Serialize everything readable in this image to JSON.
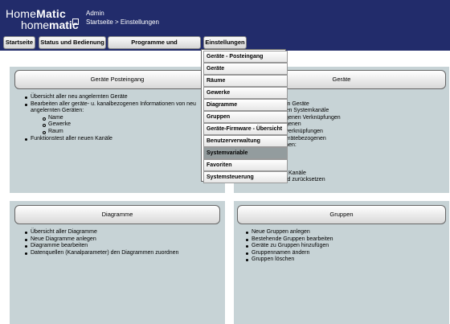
{
  "brand": {
    "line1_normal": "Home",
    "line1_bold": "Matic",
    "line2_normal": "home",
    "line2_bold": "matic"
  },
  "user": "Admin",
  "breadcrumb": "Startseite > Einstellungen",
  "nav": [
    "Startseite",
    "Status und Bedienung",
    "Programme und Verknüpfungen",
    "Einstellungen"
  ],
  "menu": {
    "items": [
      "Geräte - Posteingang",
      "Geräte",
      "Räume",
      "Gewerke",
      "Diagramme",
      "Gruppen",
      "Geräte-Firmware - Übersicht",
      "Benutzerverwaltung",
      "Systemvariable",
      "Favoriten",
      "Systemsteuerung"
    ],
    "selected": "Systemvariable"
  },
  "panels": {
    "inbox": {
      "title": "Geräte Posteingang",
      "items": [
        "Übersicht aller neu angelernten Geräte",
        "Bearbeiten aller geräte- u. kanalbezogenen Informationen von neu",
        "angelernten Geräten:"
      ],
      "subitems": [
        "Name",
        "Gewerke",
        "Raum"
      ],
      "last": "Funktionstest aller neuen Kanäle"
    },
    "devices": {
      "title": "Geräte",
      "lines": [
        "er:",
        "lernten Geräte",
        "ndenen Systemkanäle",
        "bezogenen Verknüpfungen",
        "bezogenen",
        "ammverknüpfungen",
        "ller gerätebezogenen",
        "nationen:",
        "e",
        "rk",
        "n",
        "t aller Kanäle",
        "en und zurücksetzen"
      ]
    },
    "diagrams": {
      "title": "Diagramme",
      "items": [
        "Übersicht aller Diagramme",
        "Neue Diagramme anlegen",
        "Diagramme bearbeiten",
        "Datenquellen (Kanalparameter) den Diagrammen zuordnen"
      ]
    },
    "groups": {
      "title": "Gruppen",
      "items": [
        "Neue Gruppen anlegen",
        "Bestehende Gruppen bearbeiten",
        "Geräte zu Gruppen hinzufügen",
        "Gruppennamen ändern",
        "Gruppen löschen"
      ]
    }
  }
}
